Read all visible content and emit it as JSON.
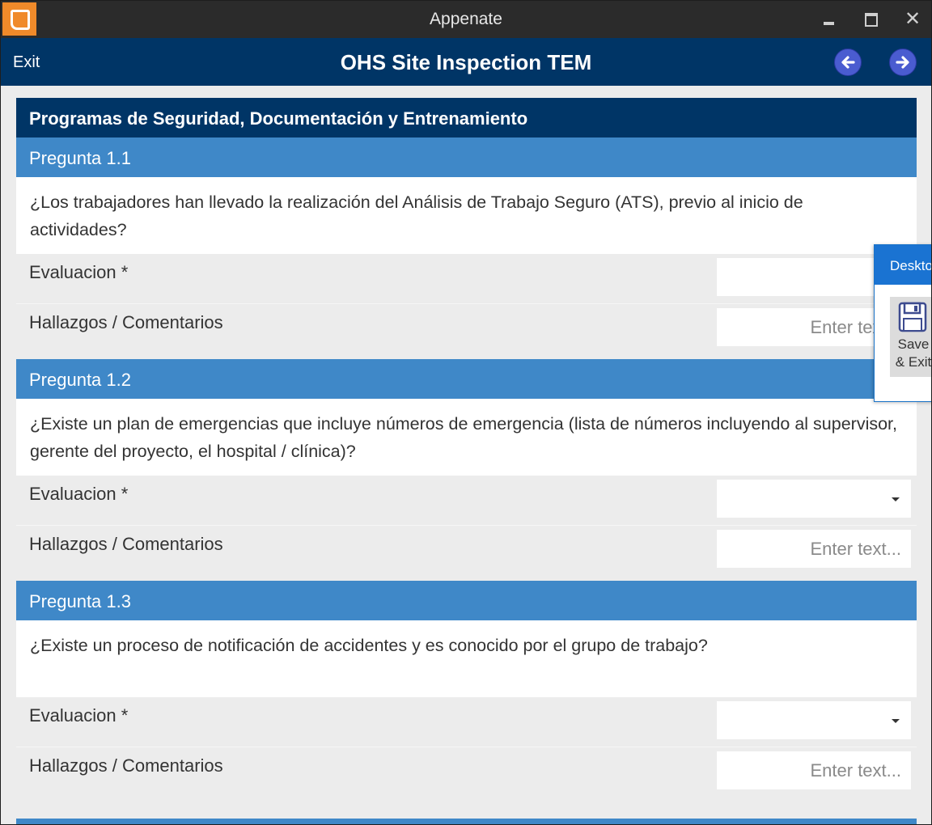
{
  "window": {
    "title": "Appenate",
    "minimize_icon": "minimize-icon",
    "maximize_icon": "maximize-icon",
    "close_glyph": "✕"
  },
  "appbar": {
    "exit_label": "Exit",
    "title": "OHS Site Inspection TEM",
    "back_icon": "arrow-left-icon",
    "forward_icon": "arrow-right-icon"
  },
  "section": {
    "title": "Programas de Seguridad, Documentación y Entrenamiento"
  },
  "questions": [
    {
      "header": "Pregunta 1.1",
      "text": "¿Los trabajadores han llevado la realización del Análisis de Trabajo Seguro (ATS), previo al inicio de actividades?",
      "evaluation_label": "Evaluacion *",
      "evaluation_value": "",
      "comments_label": "Hallazgos / Comentarios",
      "comments_placeholder": "Enter text..."
    },
    {
      "header": "Pregunta 1.2",
      "text": "¿Existe un plan de emergencias que incluye números de emergencia (lista de números incluyendo al supervisor, gerente del proyecto, el hospital / clínica)?",
      "evaluation_label": "Evaluacion *",
      "evaluation_value": "",
      "comments_label": "Hallazgos / Comentarios",
      "comments_placeholder": "Enter text..."
    },
    {
      "header": "Pregunta 1.3",
      "text": "¿Existe un proceso de notificación de accidentes y es conocido por el grupo de trabajo?",
      "evaluation_label": "Evaluacion *",
      "evaluation_value": "",
      "comments_label": "Hallazgos / Comentarios",
      "comments_placeholder": "Enter text..."
    }
  ],
  "popup": {
    "title": "Desktop",
    "save_label_1": "Save",
    "save_label_2": "& Exit",
    "save_icon": "floppy-disk-icon"
  }
}
